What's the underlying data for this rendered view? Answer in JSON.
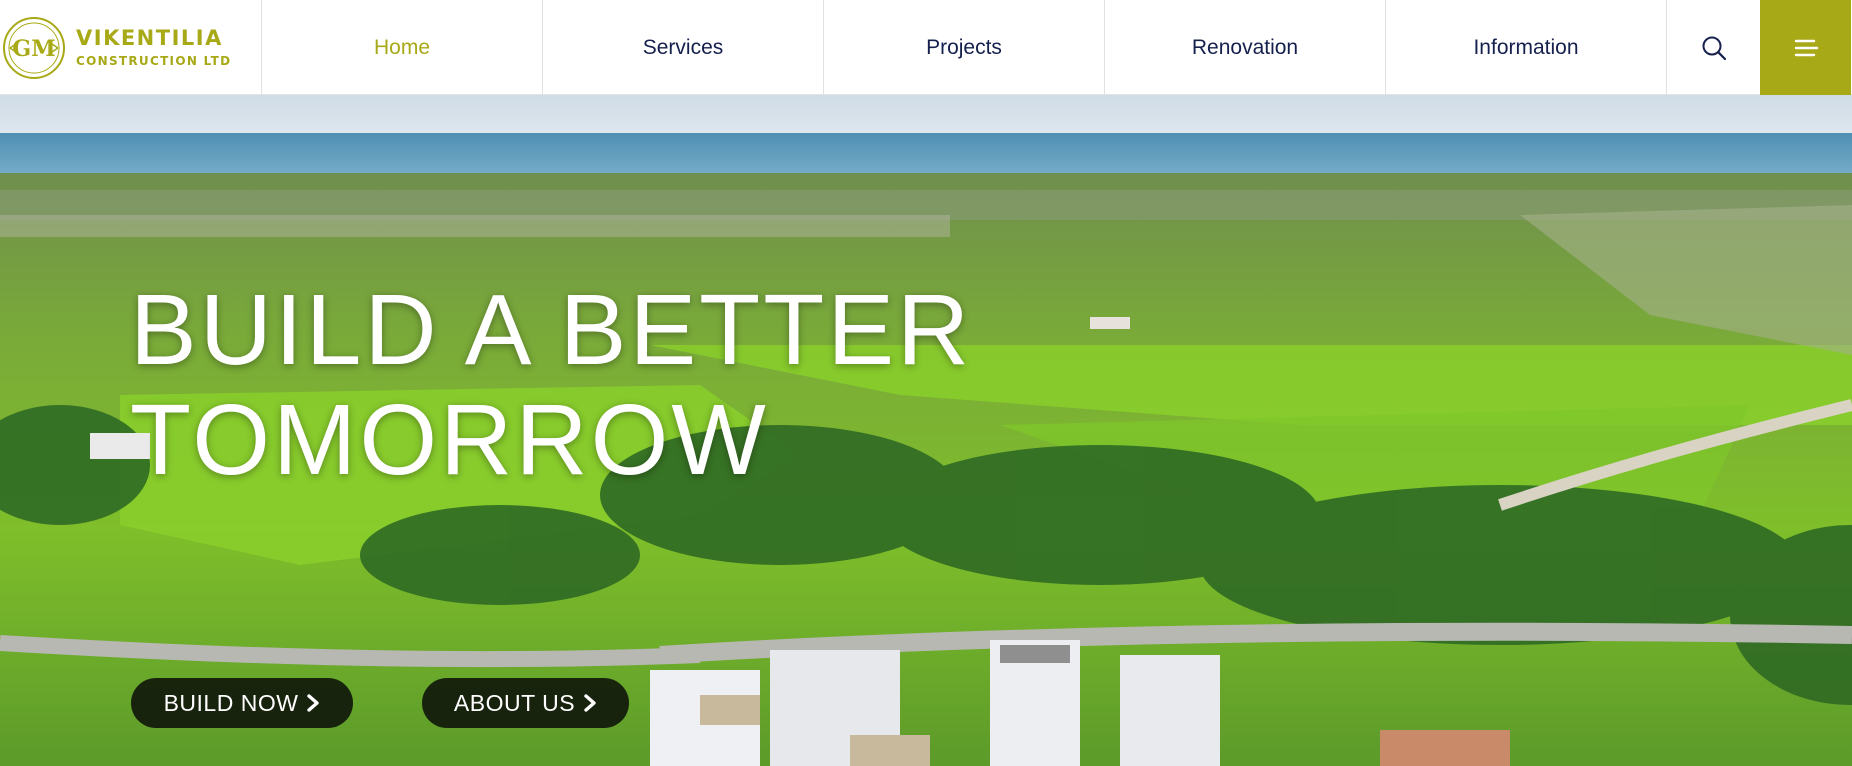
{
  "brand": {
    "monogram": "GM",
    "name_line1": "VIKENTILIA",
    "name_line2": "CONSTRUCTION LTD",
    "color": "#a8a916"
  },
  "nav": {
    "items": [
      {
        "label": "Home",
        "active": true
      },
      {
        "label": "Services"
      },
      {
        "label": "Projects"
      },
      {
        "label": "Renovation"
      },
      {
        "label": "Information"
      }
    ],
    "search_icon": "search-icon",
    "menu_icon": "hamburger-menu-icon",
    "text_color": "#16204d",
    "accent_color": "#a8a916"
  },
  "hero": {
    "headline_line1": "BUILD A BETTER",
    "headline_line2": "TOMORROW",
    "cta_build": "BUILD NOW",
    "cta_about": "ABOUT US",
    "cta_icon": "chevron-right-icon"
  }
}
